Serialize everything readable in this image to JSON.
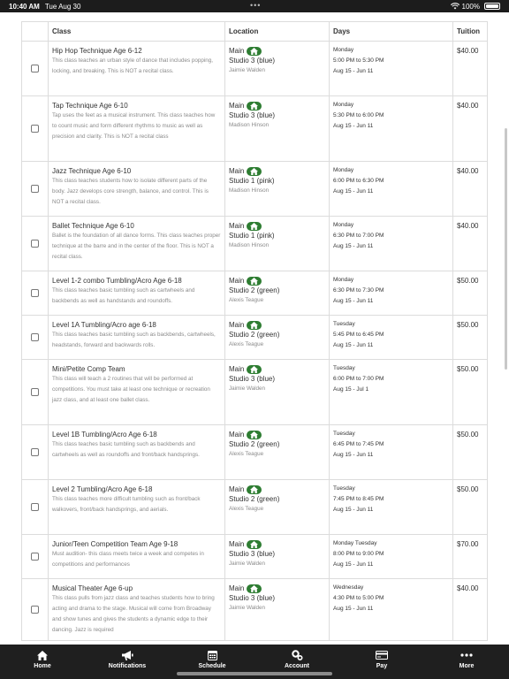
{
  "status_bar": {
    "time": "10:40 AM",
    "date": "Tue Aug 30",
    "battery": "100%"
  },
  "table": {
    "headers": [
      "Class",
      "Location",
      "Days",
      "Tuition"
    ],
    "rows": [
      {
        "name": "Hip Hop Technique Age 6-12",
        "desc": "This class teaches an urban style of dance that includes popping, locking, and breaking. This is NOT a recital class.",
        "location": "Main",
        "studio": "Studio 3 (blue)",
        "teacher": "Jaimie Walden",
        "day": "Monday",
        "time": "5:00 PM to 5:30 PM",
        "dates": "Aug 15 - Jun 11",
        "tuition": "$40.00"
      },
      {
        "name": "Tap Technique Age 6-10",
        "desc": "Tap uses the feet as a musical instrument. This class teaches how to count music and form different rhythms to music as well as precision and clarity. This is NOT a recital class",
        "location": "Main",
        "studio": "Studio 3 (blue)",
        "teacher": "Madison Hinson",
        "day": "Monday",
        "time": "5:30 PM to 6:00 PM",
        "dates": "Aug 15 - Jun 11",
        "tuition": "$40.00"
      },
      {
        "name": "Jazz Technique Age 6-10",
        "desc": "This class teaches students how to isolate different parts of the body. Jazz develops core strength, balance, and control. This is NOT a recital class.",
        "location": "Main",
        "studio": "Studio 1 (pink)",
        "teacher": "Madison Hinson",
        "day": "Monday",
        "time": "6:00 PM to 6:30 PM",
        "dates": "Aug 15 - Jun 11",
        "tuition": "$40.00"
      },
      {
        "name": "Ballet Technique Age 6-10",
        "desc": "Ballet is the foundation of all dance forms. This class teaches proper technique at the barre and in the center of the floor. This is NOT a recital class.",
        "location": "Main",
        "studio": "Studio 1 (pink)",
        "teacher": "Madison Hinson",
        "day": "Monday",
        "time": "6:30 PM to 7:00 PM",
        "dates": "Aug 15 - Jun 11",
        "tuition": "$40.00"
      },
      {
        "name": "Level 1-2 combo Tumbling/Acro Age 6-18",
        "desc": "This class teaches basic tumbling such as cartwheels and backbends as well as handstands and roundoffs.",
        "location": "Main",
        "studio": "Studio 2 (green)",
        "teacher": "Alexis Teague",
        "day": "Monday",
        "time": "6:30 PM to 7:30 PM",
        "dates": "Aug 15 - Jun 11",
        "tuition": "$50.00"
      },
      {
        "name": "Level 1A Tumbling/Acro age 6-18",
        "desc": "This class teaches basic tumbling such as backbends, cartwheels, headstands, forward and backwards rolls.",
        "location": "Main",
        "studio": "Studio 2 (green)",
        "teacher": "Alexis Teague",
        "day": "Tuesday",
        "time": "5:45 PM to 6:45 PM",
        "dates": "Aug 15 - Jun 11",
        "tuition": "$50.00"
      },
      {
        "name": "Mini/Petite Comp Team",
        "desc": "This class will teach a 2 routines that will be performed at competitions. You must take at least one technique or recreation jazz class, and at least one ballet class.",
        "location": "Main",
        "studio": "Studio 3 (blue)",
        "teacher": "Jaimie Walden",
        "day": "Tuesday",
        "time": "6:00 PM to 7:00 PM",
        "dates": "Aug 15 - Jul 1",
        "tuition": "$50.00"
      },
      {
        "name": "Level 1B Tumbling/Acro Age 6-18",
        "desc": "This class teaches basic tumbling such as backbends and cartwheels as well as roundoffs and front/back handsprings.",
        "location": "Main",
        "studio": "Studio 2 (green)",
        "teacher": "Alexis Teague",
        "day": "Tuesday",
        "time": "6:45 PM to 7:45 PM",
        "dates": "Aug 15 - Jun 11",
        "tuition": "$50.00"
      },
      {
        "name": "Level 2 Tumbling/Acro Age 6-18",
        "desc": "This class teaches more difficult tumbling such as front/back walkovers, front/back handsprings, and aerials.",
        "location": "Main",
        "studio": "Studio 2 (green)",
        "teacher": "Alexis Teague",
        "day": "Tuesday",
        "time": "7:45 PM to 8:45 PM",
        "dates": "Aug 15 - Jun 11",
        "tuition": "$50.00"
      },
      {
        "name": "Junior/Teen Competition Team Age 9-18",
        "desc": "Must audition- this class meets twice a week and competes in competitions and performances",
        "location": "Main",
        "studio": "Studio 3 (blue)",
        "teacher": "Jaimie Walden",
        "day": "Monday Tuesday",
        "time": "8:00 PM to 9:00 PM",
        "dates": "Aug 15 - Jun 11",
        "tuition": "$70.00"
      },
      {
        "name": "Musical Theater Age 6-up",
        "desc": "This class pulls from jazz class and teaches students how to bring acting and drama to the stage. Musical will come from Broadway and show tunes and gives the students a dynamic edge to their dancing. Jazz is required",
        "location": "Main",
        "studio": "Studio 3 (blue)",
        "teacher": "Jaimie Walden",
        "day": "Wednesday",
        "time": "4:30 PM to 5:00 PM",
        "dates": "Aug 15 - Jun 11",
        "tuition": "$40.00"
      }
    ]
  },
  "tabs": [
    {
      "label": "Home",
      "icon": "home-icon"
    },
    {
      "label": "Notifications",
      "icon": "megaphone-icon"
    },
    {
      "label": "Schedule",
      "icon": "calendar-icon"
    },
    {
      "label": "Account",
      "icon": "gears-icon"
    },
    {
      "label": "Pay",
      "icon": "credit-card-icon"
    },
    {
      "label": "More",
      "icon": "more-icon"
    }
  ],
  "colors": {
    "location_badge": "#2e7d32",
    "tab_bar": "#1f1f1f",
    "status_bar": "#1c1c1c"
  }
}
